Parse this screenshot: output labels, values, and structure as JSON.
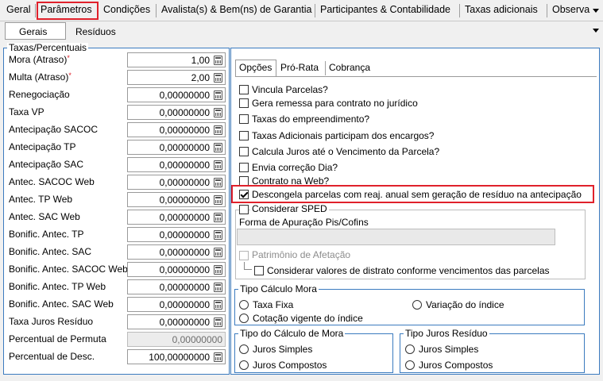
{
  "top_tabs": [
    {
      "label": "Geral"
    },
    {
      "label": "Parâmetros"
    },
    {
      "label": "Condições"
    },
    {
      "label": "Avalista(s) & Bem(ns) de Garantia"
    },
    {
      "label": "Participantes & Contabilidade"
    },
    {
      "label": "Taxas adicionais"
    },
    {
      "label": "Observa"
    }
  ],
  "sub_tabs": [
    {
      "label": "Gerais"
    },
    {
      "label": "Resíduos"
    }
  ],
  "taxas": {
    "legend": "Taxas/Percentuais",
    "rows": [
      {
        "label": "Mora (Atraso)",
        "value": "1,00",
        "required": "*"
      },
      {
        "label": "Multa (Atraso)",
        "value": "2,00",
        "required": "*"
      },
      {
        "label": "Renegociação",
        "value": "0,00000000"
      },
      {
        "label": "Taxa VP",
        "value": "0,00000000"
      },
      {
        "label": "Antecipação SACOC",
        "value": "0,00000000"
      },
      {
        "label": "Antecipação TP",
        "value": "0,00000000"
      },
      {
        "label": "Antecipação SAC",
        "value": "0,00000000"
      },
      {
        "label": "Antec. SACOC Web",
        "value": "0,00000000"
      },
      {
        "label": "Antec. TP Web",
        "value": "0,00000000"
      },
      {
        "label": "Antec. SAC Web",
        "value": "0,00000000"
      },
      {
        "label": "Bonific. Antec. TP",
        "value": "0,00000000"
      },
      {
        "label": "Bonific. Antec. SAC",
        "value": "0,00000000"
      },
      {
        "label": "Bonific. Antec. SACOC Web",
        "value": "0,00000000"
      },
      {
        "label": "Bonific. Antec. TP Web",
        "value": "0,00000000"
      },
      {
        "label": "Bonific. Antec. SAC Web",
        "value": "0,00000000"
      },
      {
        "label": "Taxa Juros Resíduo",
        "value": "0,00000000"
      },
      {
        "label": "Percentual de Permuta",
        "value": "0,00000000",
        "disabled": true
      },
      {
        "label": "Percentual de Desc.",
        "value": "100,00000000"
      }
    ]
  },
  "inner_tabs": [
    {
      "label": "Opções"
    },
    {
      "label": "Pró-Rata"
    },
    {
      "label": "Cobrança"
    }
  ],
  "options": [
    {
      "label": "Vincula Parcelas?",
      "checked": false
    },
    {
      "label": "Gera remessa para contrato no jurídico",
      "checked": false
    },
    {
      "label": "Taxas do empreendimento?",
      "checked": false
    },
    {
      "label": "Taxas Adicionais participam dos encargos?",
      "checked": false
    },
    {
      "label": "Calcula Juros até o Vencimento da Parcela?",
      "checked": false
    },
    {
      "label": "Envia correção Dia?",
      "checked": false
    },
    {
      "label": "Contrato na Web?",
      "checked": false
    },
    {
      "label": "Descongela parcelas com reaj. anual sem geração de resíduo na antecipação",
      "checked": true
    },
    {
      "label": "Considerar SPED",
      "checked": false
    }
  ],
  "sped": {
    "pis_label": "Forma de Apuração Pis/Cofins",
    "patrimonio_label": "Patrimônio de Afetação",
    "distrato_label": "Considerar valores de distrato conforme vencimentos das parcelas"
  },
  "tipo_calculo_mora_1": {
    "legend": "Tipo Cálculo Mora",
    "options": [
      "Taxa Fixa",
      "Variação do índice",
      "Cotação vigente do índice"
    ]
  },
  "tipo_calculo_mora_2": {
    "legend": "Tipo do Cálculo de Mora",
    "options": [
      "Juros Simples",
      "Juros Compostos"
    ]
  },
  "tipo_juros_residuo": {
    "legend": "Tipo Juros Resíduo",
    "options": [
      "Juros Simples",
      "Juros Compostos"
    ]
  },
  "colors": {
    "accent": "#3b7bbf",
    "highlight": "#e0212b",
    "background": "#f0f0f0"
  }
}
